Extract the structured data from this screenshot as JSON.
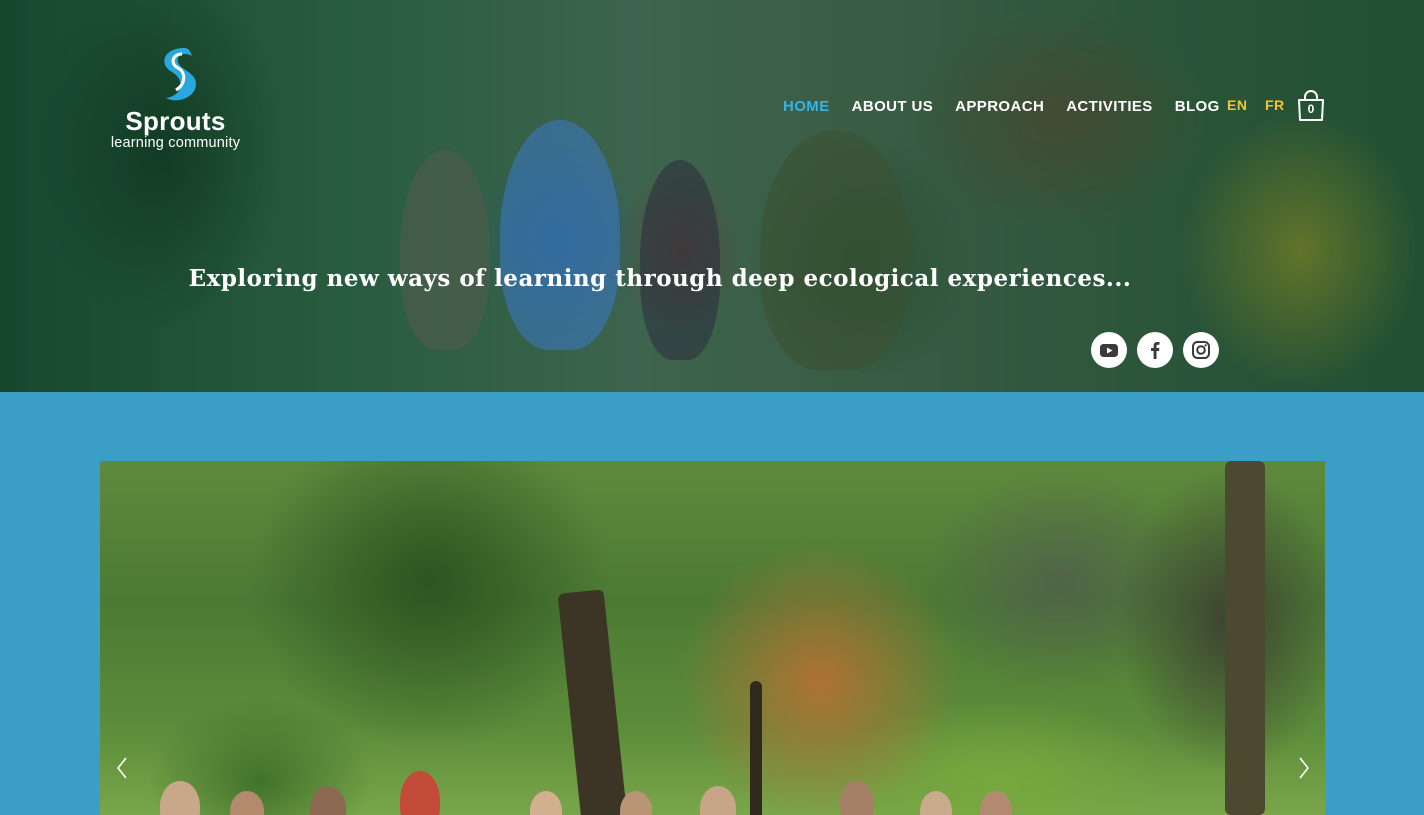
{
  "logo": {
    "brand": "Sprouts",
    "subtitle": "learning community",
    "colors": {
      "swirl": "#29a8e0",
      "text": "#ffffff"
    }
  },
  "nav": {
    "items": [
      {
        "label": "HOME",
        "active": true
      },
      {
        "label": "ABOUT US",
        "active": false
      },
      {
        "label": "APPROACH",
        "active": false
      },
      {
        "label": "ACTIVITIES",
        "active": false
      },
      {
        "label": "BLOG",
        "active": false
      }
    ],
    "active_color": "#33b4e6"
  },
  "languages": {
    "en": "EN",
    "fr": "FR",
    "color": "#f4c430"
  },
  "cart": {
    "icon": "shopping-bag-icon",
    "count": "0"
  },
  "hero": {
    "tagline": "Exploring new ways of learning through deep ecological experiences..."
  },
  "social": [
    {
      "icon": "youtube-icon",
      "name": "youtube"
    },
    {
      "icon": "facebook-icon",
      "name": "facebook"
    },
    {
      "icon": "instagram-icon",
      "name": "instagram"
    }
  ],
  "gallery": {
    "prev_icon": "chevron-left-icon",
    "next_icon": "chevron-right-icon"
  },
  "page": {
    "background": "#3a9ec7"
  }
}
